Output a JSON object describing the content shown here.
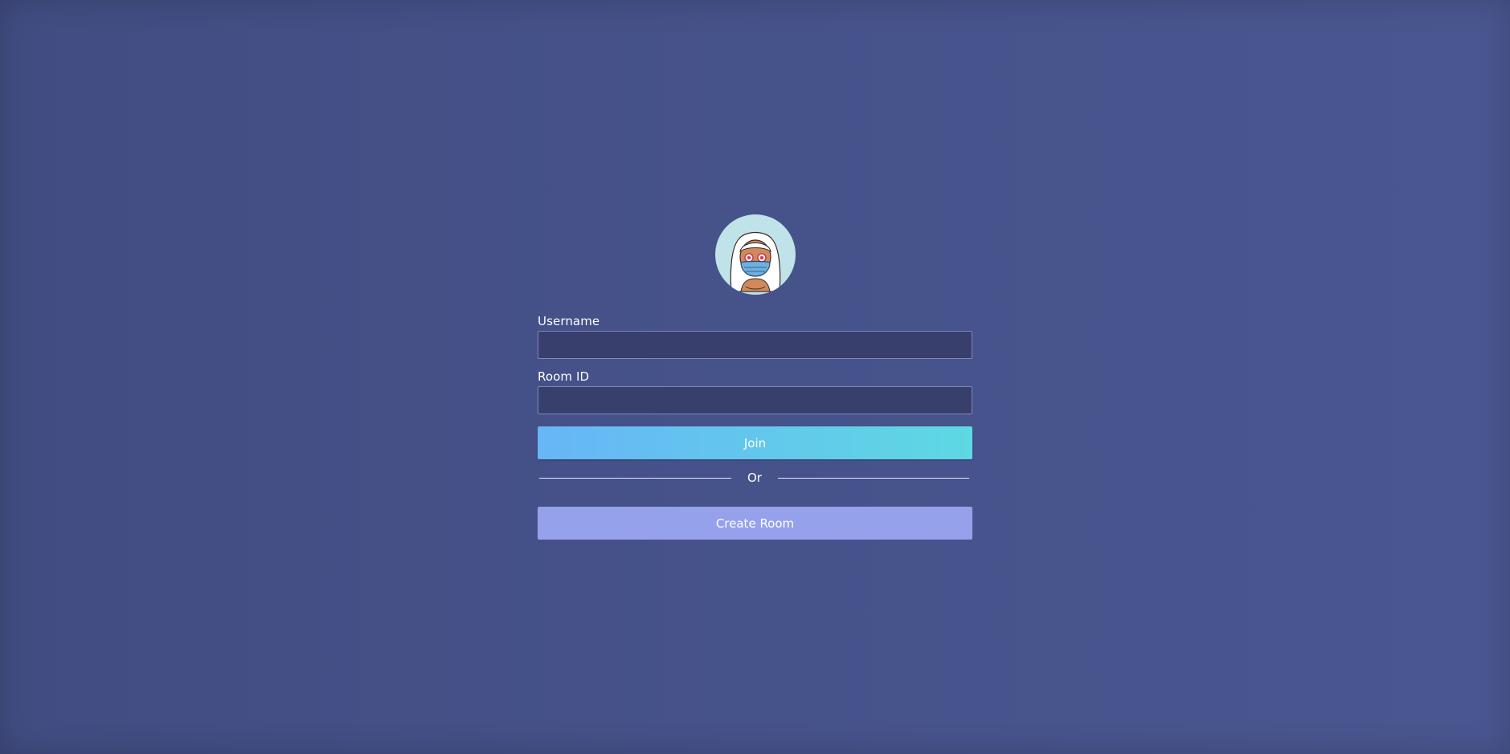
{
  "login": {
    "avatar_icon": "masked-avatar-illustration",
    "username_label": "Username",
    "username_value": "",
    "roomid_label": "Room ID",
    "roomid_value": "",
    "join_label": "Join",
    "divider_text": "Or",
    "create_label": "Create Room"
  },
  "colors": {
    "background": "#45518a",
    "input_background": "#383f6c",
    "join_gradient_start": "#67b6f6",
    "join_gradient_end": "#5ed8e3",
    "create_button": "#95a1ea",
    "avatar_background": "#bfe3e8"
  }
}
